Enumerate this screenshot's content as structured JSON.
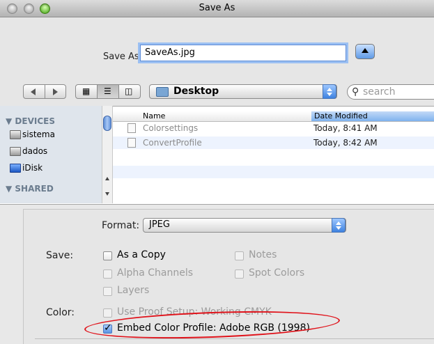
{
  "window": {
    "title": "Save As"
  },
  "save_as": {
    "label": "Save As:",
    "value": "SaveAs.jpg"
  },
  "toolbar": {
    "view_icons": [
      "icon-view-icon",
      "list-view-icon",
      "column-view-icon"
    ],
    "location": "Desktop",
    "search_placeholder": "search"
  },
  "sidebar": {
    "devices_header": "▼ DEVICES",
    "devices": [
      "sistema",
      "dados",
      "iDisk"
    ],
    "shared_header": "▼ SHARED"
  },
  "file_list": {
    "columns": [
      "Name",
      "Date Modified"
    ],
    "rows": [
      {
        "name": "Colorsettings",
        "date": "Today, 8:41 AM"
      },
      {
        "name": "ConvertProfile",
        "date": "Today, 8:42 AM"
      }
    ]
  },
  "options": {
    "format_label": "Format:",
    "format_value": "JPEG",
    "save_label": "Save:",
    "as_copy": "As a Copy",
    "notes": "Notes",
    "alpha_channels": "Alpha Channels",
    "spot_colors": "Spot Colors",
    "layers": "Layers",
    "color_label": "Color:",
    "use_proof": "Use Proof Setup:  Working CMYK",
    "embed_profile": "Embed Color Profile:  Adobe RGB (1998)",
    "embed_checked": true,
    "annotation_color": "#e0121a"
  }
}
